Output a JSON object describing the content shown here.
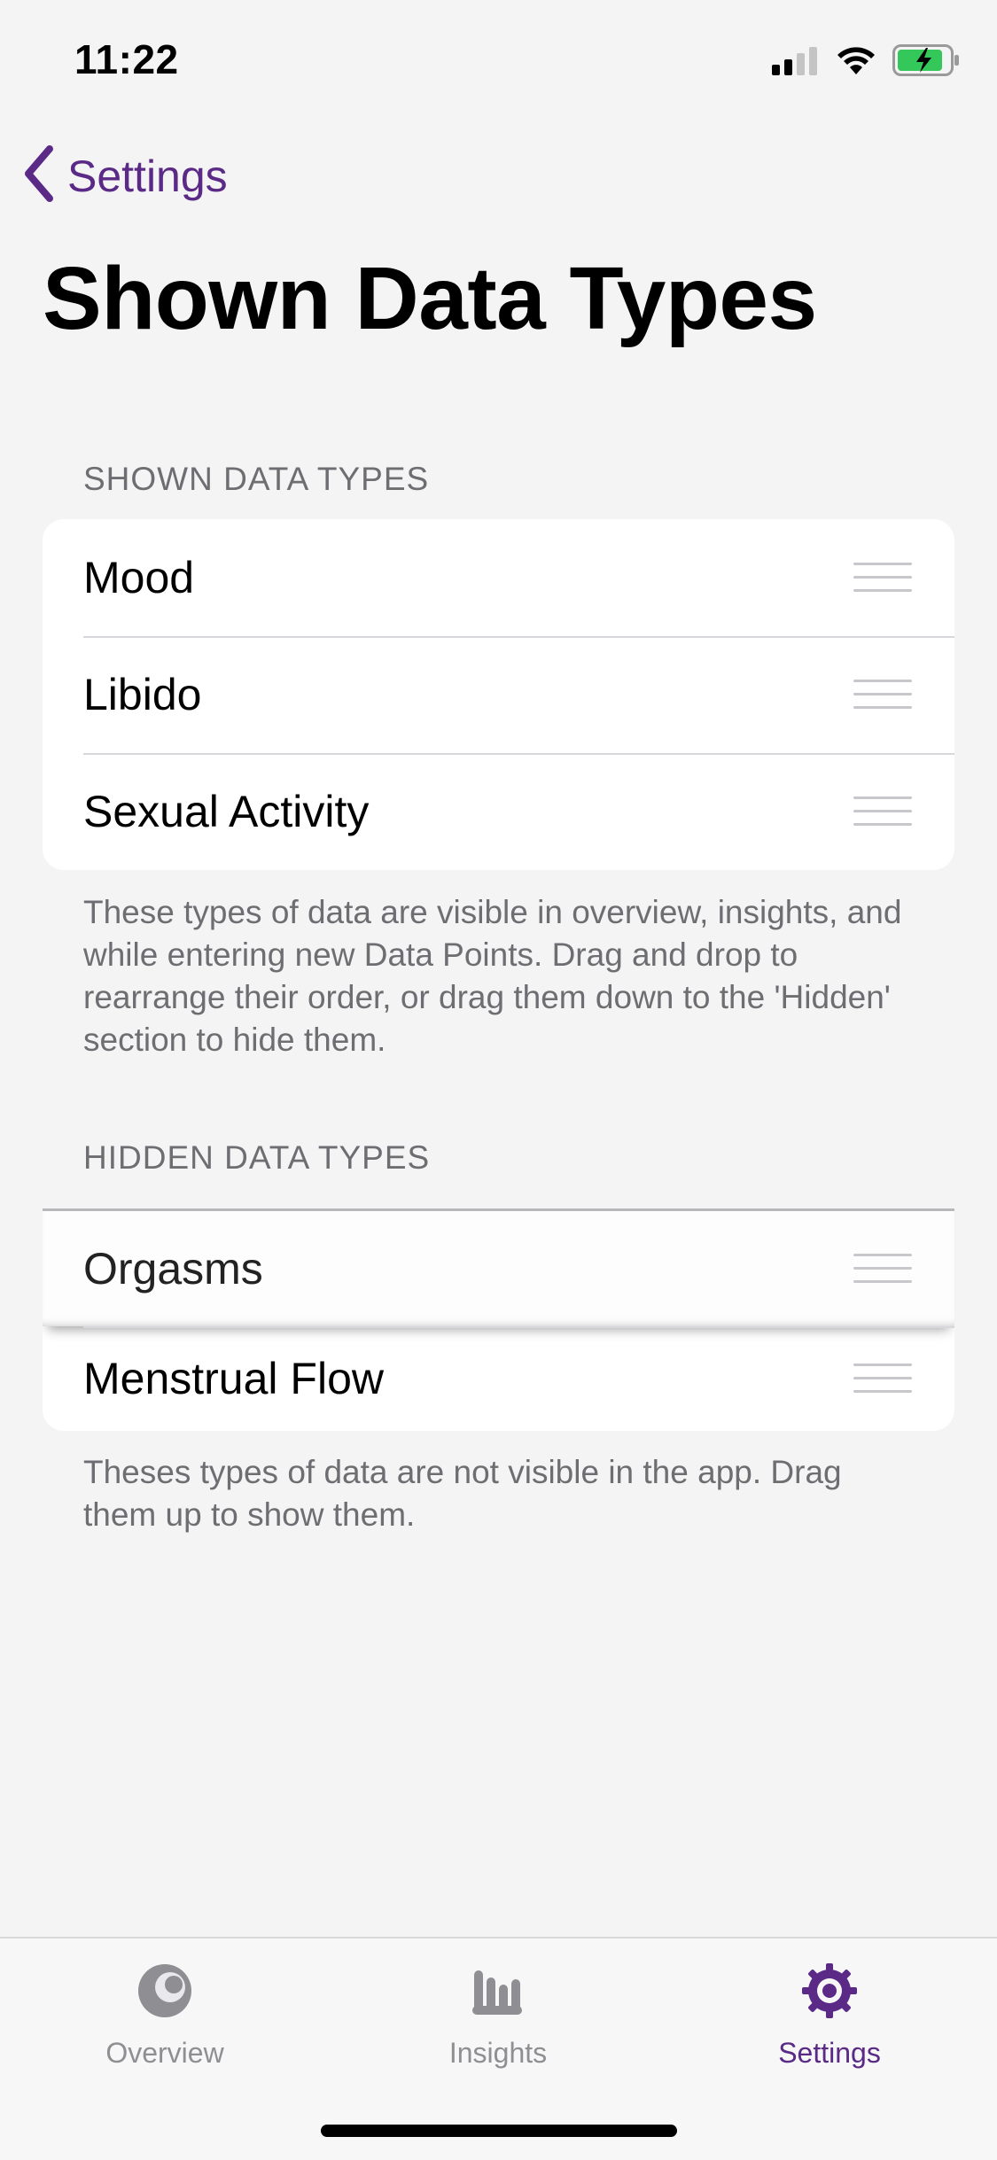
{
  "status_bar": {
    "time": "11:22",
    "signal_icon": "cellular-signal-icon",
    "wifi_icon": "wifi-icon",
    "battery_icon": "battery-charging-icon",
    "battery_color": "#34c759"
  },
  "nav": {
    "back_label": "Settings",
    "back_icon": "chevron-left-icon",
    "accent_color": "#5a2a86"
  },
  "page": {
    "title": "Shown Data Types"
  },
  "shown_section": {
    "header": "SHOWN DATA TYPES",
    "items": [
      {
        "label": "Mood",
        "handle_icon": "drag-handle-icon"
      },
      {
        "label": "Libido",
        "handle_icon": "drag-handle-icon"
      },
      {
        "label": "Sexual Activity",
        "handle_icon": "drag-handle-icon"
      }
    ],
    "footer": "These types of data are visible in overview, insights, and while entering new Data Points. Drag and drop to rearrange their order, or drag them down to the 'Hidden' section to hide them."
  },
  "hidden_section": {
    "header": "HIDDEN DATA TYPES",
    "items": [
      {
        "label": "Orgasms",
        "handle_icon": "drag-handle-icon",
        "state": "dragging"
      },
      {
        "label": "Menstrual Flow",
        "handle_icon": "drag-handle-icon"
      }
    ],
    "footer": "Theses types of data are not visible in the app. Drag them up to show them."
  },
  "tab_bar": {
    "tabs": [
      {
        "label": "Overview",
        "icon": "overview-icon",
        "active": false
      },
      {
        "label": "Insights",
        "icon": "insights-icon",
        "active": false
      },
      {
        "label": "Settings",
        "icon": "settings-icon",
        "active": true
      }
    ],
    "active_color": "#5a2a86",
    "inactive_color": "#8e8e93"
  }
}
